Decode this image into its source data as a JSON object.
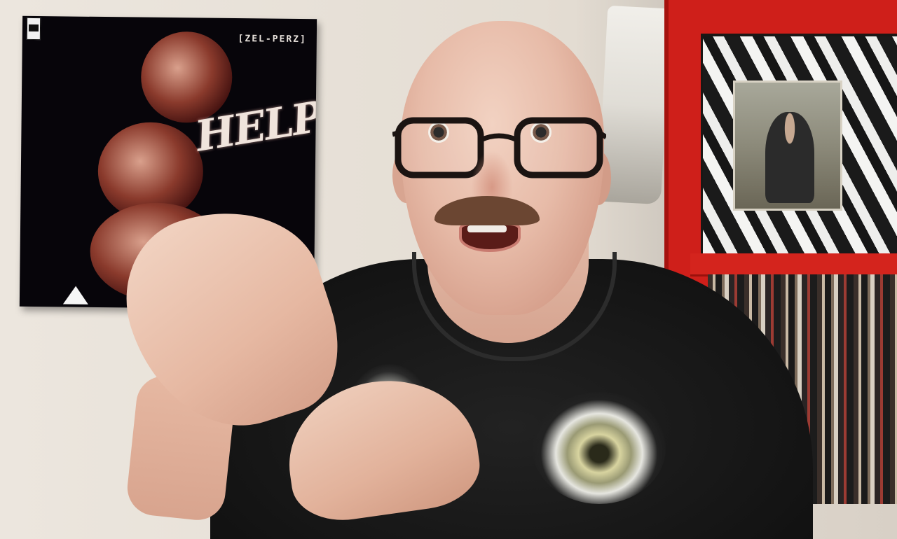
{
  "poster": {
    "title": "[ZEL-PERZ]",
    "word": "HELP"
  }
}
